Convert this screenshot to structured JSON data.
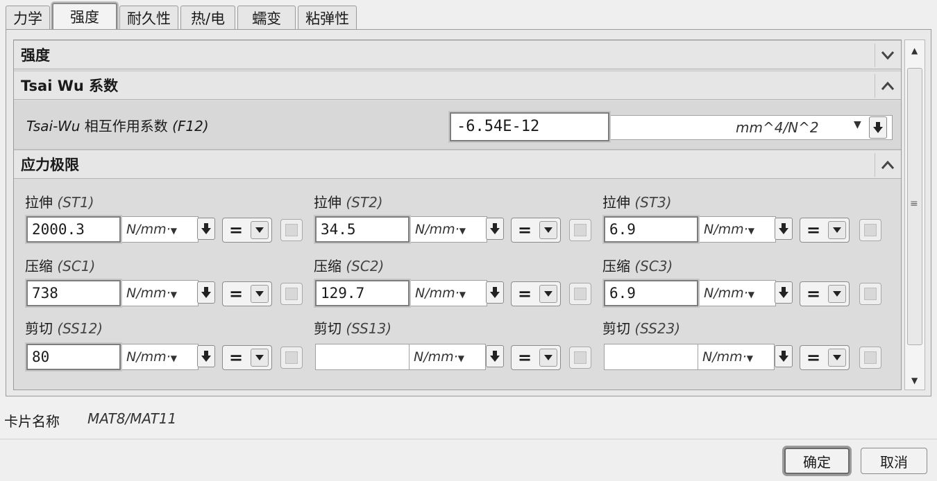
{
  "tabs": [
    {
      "label": "力学"
    },
    {
      "label": "强度",
      "active": true
    },
    {
      "label": "耐久性"
    },
    {
      "label": "热/电"
    },
    {
      "label": "蠕变"
    },
    {
      "label": "粘弹性"
    }
  ],
  "sections": {
    "strength": {
      "title": "强度"
    },
    "tsai_wu": {
      "title": "Tsai Wu 系数",
      "field": {
        "label_prefix": "Tsai-Wu",
        "label_mid": " 相互作用系数 ",
        "label_code": "(F12)",
        "value": "-6.54E-12",
        "unit": "mm^4/N^2"
      }
    },
    "stress_limits": {
      "title": "应力极限",
      "fields": [
        {
          "label": "拉伸",
          "code": "(ST1)",
          "value": "2000.3",
          "unit": "N/mm"
        },
        {
          "label": "拉伸",
          "code": "(ST2)",
          "value": "34.5",
          "unit": "N/mm"
        },
        {
          "label": "拉伸",
          "code": "(ST3)",
          "value": "6.9",
          "unit": "N/mm"
        },
        {
          "label": "压缩",
          "code": "(SC1)",
          "value": "738",
          "unit": "N/mm"
        },
        {
          "label": "压缩",
          "code": "(SC2)",
          "value": "129.7",
          "unit": "N/mm"
        },
        {
          "label": "压缩",
          "code": "(SC3)",
          "value": "6.9",
          "unit": "N/mm"
        },
        {
          "label": "剪切",
          "code": "(SS12)",
          "value": "80",
          "unit": "N/mm"
        },
        {
          "label": "剪切",
          "code": "(SS13)",
          "value": "",
          "unit": "N/mm"
        },
        {
          "label": "剪切",
          "code": "(SS23)",
          "value": "",
          "unit": "N/mm"
        }
      ],
      "operator": "="
    }
  },
  "card": {
    "label": "卡片名称",
    "value": "MAT8/MAT11"
  },
  "buttons": {
    "ok": "确定",
    "cancel": "取消"
  }
}
